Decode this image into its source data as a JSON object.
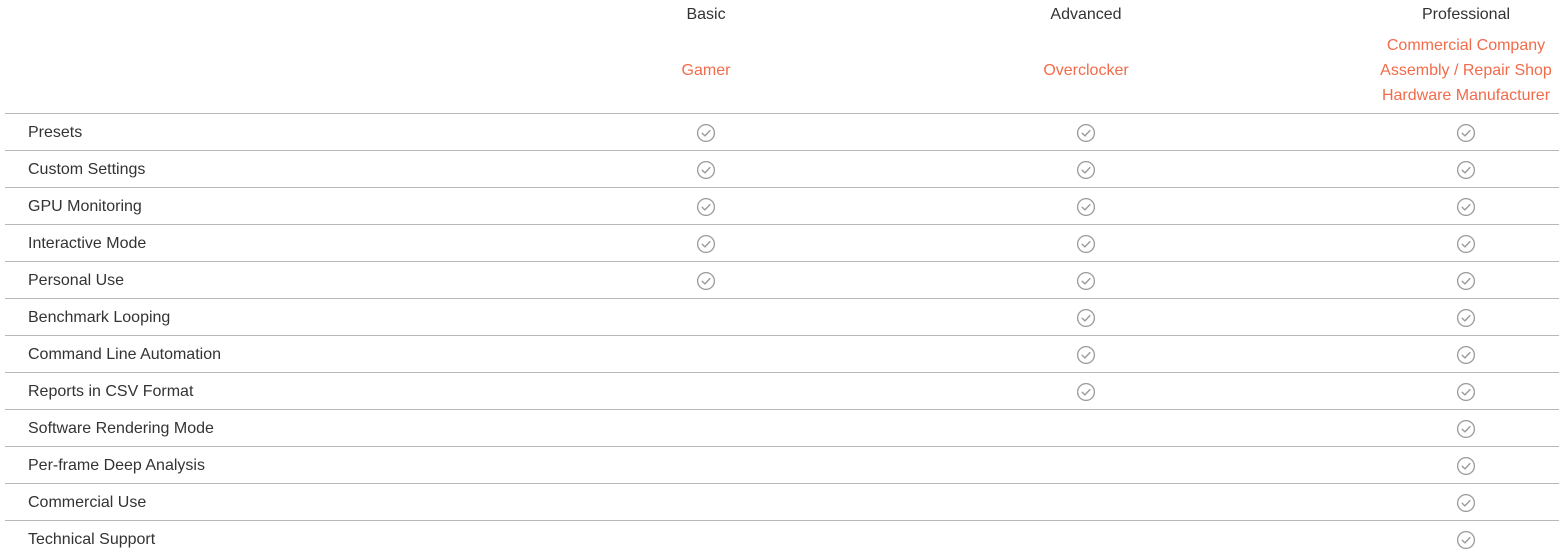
{
  "plans": [
    {
      "name": "Basic",
      "audience": [
        "Gamer"
      ]
    },
    {
      "name": "Advanced",
      "audience": [
        "Overclocker"
      ]
    },
    {
      "name": "Professional",
      "audience": [
        "Commercial Company",
        "Assembly / Repair Shop",
        "Hardware Manufacturer"
      ]
    }
  ],
  "features": [
    {
      "label": "Presets",
      "basic": true,
      "advanced": true,
      "professional": true
    },
    {
      "label": "Custom Settings",
      "basic": true,
      "advanced": true,
      "professional": true
    },
    {
      "label": "GPU Monitoring",
      "basic": true,
      "advanced": true,
      "professional": true
    },
    {
      "label": "Interactive Mode",
      "basic": true,
      "advanced": true,
      "professional": true
    },
    {
      "label": "Personal Use",
      "basic": true,
      "advanced": true,
      "professional": true
    },
    {
      "label": "Benchmark Looping",
      "basic": false,
      "advanced": true,
      "professional": true
    },
    {
      "label": "Command Line Automation",
      "basic": false,
      "advanced": true,
      "professional": true
    },
    {
      "label": "Reports in CSV Format",
      "basic": false,
      "advanced": true,
      "professional": true
    },
    {
      "label": "Software Rendering Mode",
      "basic": false,
      "advanced": false,
      "professional": true
    },
    {
      "label": "Per-frame Deep Analysis",
      "basic": false,
      "advanced": false,
      "professional": true
    },
    {
      "label": "Commercial Use",
      "basic": false,
      "advanced": false,
      "professional": true
    },
    {
      "label": "Technical Support",
      "basic": false,
      "advanced": false,
      "professional": true
    }
  ],
  "colors": {
    "accent": "#f26b4a",
    "text": "#333333",
    "divider": "#b8b8b8",
    "check": "#9a9a9a"
  },
  "icons": {
    "included": "check-circle-icon"
  }
}
